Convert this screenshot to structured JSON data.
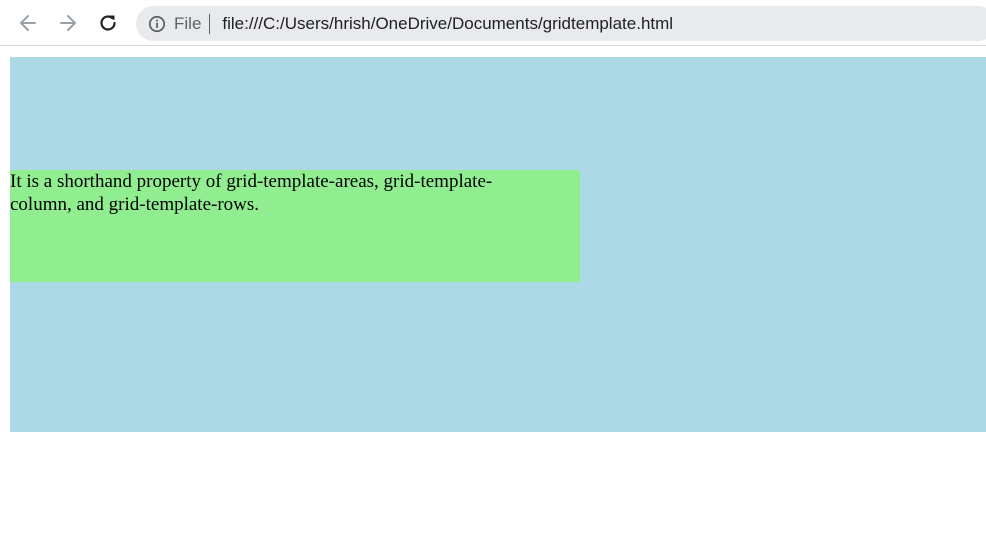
{
  "browser": {
    "toolbar": {
      "back_icon": "arrow-left-icon",
      "forward_icon": "arrow-right-icon",
      "reload_icon": "reload-icon"
    },
    "omnibox": {
      "info_icon": "info-circle-icon",
      "scheme_label": "File",
      "url": "file:///C:/Users/hrish/OneDrive/Documents/gridtemplate.html"
    }
  },
  "page": {
    "grid_container_color": "#add8e6",
    "grid_item_color": "#90ee90",
    "grid_item_text": "It is a shorthand property of grid-template-areas, grid-template-column, and grid-template-rows."
  }
}
